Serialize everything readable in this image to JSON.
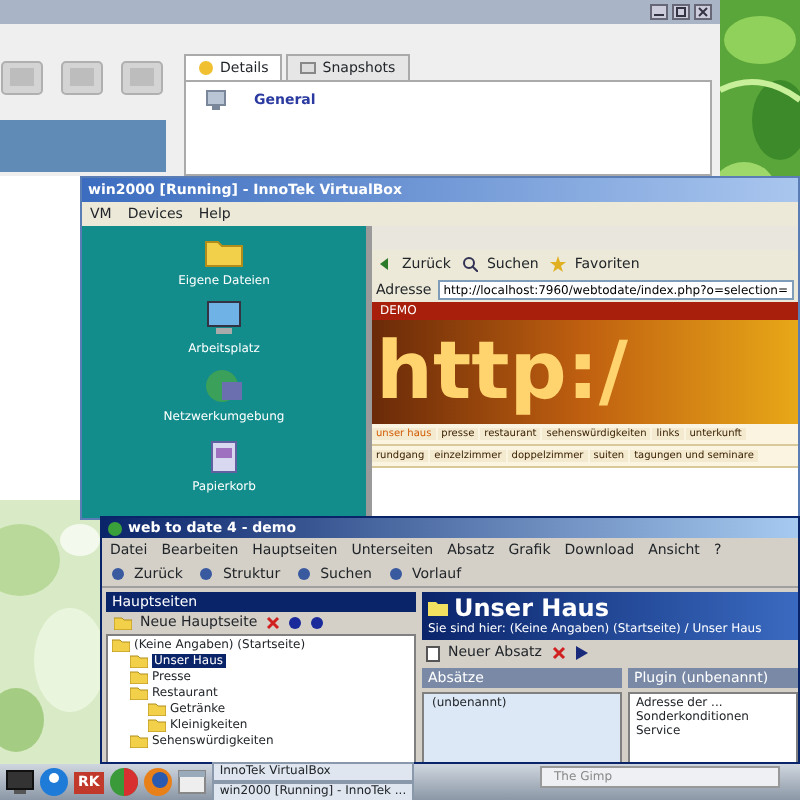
{
  "manager_window": {
    "tabs": [
      {
        "label": "Details",
        "selected": true
      },
      {
        "label": "Snapshots",
        "selected": false
      }
    ],
    "section_title": "General"
  },
  "vm_window": {
    "title": "win2000 [Running] - InnoTek VirtualBox",
    "menu": [
      "VM",
      "Devices",
      "Help"
    ],
    "desktop_icons": [
      {
        "kind": "folder",
        "label": "Eigene Dateien"
      },
      {
        "kind": "computer",
        "label": "Arbeitsplatz"
      },
      {
        "kind": "network",
        "label": "Netzwerkumgebung"
      },
      {
        "kind": "trash",
        "label": "Papierkorb"
      }
    ],
    "browser": {
      "toolbar": [
        "Zurück",
        "Suchen",
        "Favoriten"
      ],
      "address_label": "Adresse",
      "url": "http://localhost:7960/webtodate/index.php?o=selection=",
      "site": {
        "badge": "DEMO",
        "banner": "http:/",
        "nav_rows": [
          [
            {
              "label": "unser haus",
              "selected": true
            },
            {
              "label": "presse",
              "selected": false
            },
            {
              "label": "restaurant",
              "selected": false
            },
            {
              "label": "sehenswürdigkeiten",
              "selected": false
            },
            {
              "label": "links",
              "selected": false
            },
            {
              "label": "unterkunft",
              "selected": false
            }
          ],
          [
            {
              "label": "rundgang",
              "selected": false
            },
            {
              "label": "einzelzimmer",
              "selected": false
            },
            {
              "label": "doppelzimmer",
              "selected": false
            },
            {
              "label": "suiten",
              "selected": false
            },
            {
              "label": "tagungen und seminare",
              "selected": false
            }
          ]
        ]
      }
    }
  },
  "editor_window": {
    "title": "web to date 4 - demo",
    "menu": [
      "Datei",
      "Bearbeiten",
      "Hauptseiten",
      "Unterseiten",
      "Absatz",
      "Grafik",
      "Download",
      "Ansicht",
      "?"
    ],
    "toolbar": [
      "Zurück",
      "Struktur",
      "Suchen",
      "Vorlauf"
    ],
    "sidebar": {
      "title": "Hauptseiten",
      "new_button": "Neue Hauptseite",
      "tree": [
        {
          "label": "(Keine Angaben) (Startseite)",
          "selected": false,
          "children": [
            {
              "label": "Unser Haus",
              "selected": true
            },
            {
              "label": "Presse",
              "selected": false
            },
            {
              "label": "Restaurant",
              "selected": false,
              "children": [
                {
                  "label": "Getränke",
                  "selected": false
                },
                {
                  "label": "Kleinigkeiten",
                  "selected": false
                }
              ]
            },
            {
              "label": "Sehenswürdigkeiten",
              "selected": false
            }
          ]
        }
      ]
    },
    "page": {
      "title": "Unser Haus",
      "breadcrumb": "Sie sind hier: (Keine Angaben) (Startseite) / Unser Haus",
      "new_paragraph": "Neuer Absatz",
      "paragraphs_title": "Absätze",
      "paragraphs": [
        "(unbenannt)"
      ],
      "plugin_title": "Plugin (unbenannt)",
      "preview_lines": [
        "Adresse der ...",
        "Sonderkonditionen",
        "Service"
      ]
    }
  },
  "taskbar": {
    "launcher_badge": "RK",
    "tasks": [
      "InnoTek VirtualBox",
      "win2000 [Running] - InnoTek ..."
    ],
    "popup": "The Gimp"
  }
}
